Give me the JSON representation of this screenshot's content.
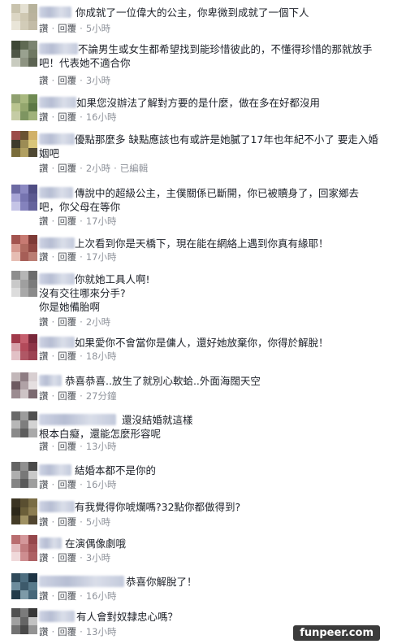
{
  "actions": {
    "like": "讚",
    "reply": "回覆",
    "edited": "已編輯"
  },
  "comments": [
    {
      "text": "你成就了一位偉大的公主，你卑微到成就了一個下人",
      "time": "5小時"
    },
    {
      "text": "不論男生或女生都希望找到能珍惜彼此的，不懂得珍惜的那就放手吧！代表她不適合你",
      "time": "3小時"
    },
    {
      "text": "如果您沒辦法了解對方要的是什麼，做在多在好都沒用",
      "time": "16小時"
    },
    {
      "text": "優點那麼多 缺點應該也有或許是她膩了17年也年紀不小了 要走入婚姻吧",
      "time": "2小時"
    },
    {
      "text": "傳說中的超級公主，主僕關係已斷開，你已被贖身了，回家鄉去吧，你父母在等你",
      "time": "17小時"
    },
    {
      "text": "上次看到你是天橋下，現在能在網絡上遇到你真有緣耶！",
      "time": "17小時"
    },
    {
      "text": "你就她工具人啊!\n沒有交往哪來分手?\n你是她備胎啊",
      "time": "2小時"
    },
    {
      "text": "如果愛你不會當你是傭人，還好她放棄你，你得於解脫！",
      "time": "18小時"
    },
    {
      "text": "恭喜恭喜..放生了就別心軟蛤..外面海闊天空",
      "time": "27分鐘"
    },
    {
      "text": "還沒結婚就這樣\n根本白癡，還能怎麼形容呢",
      "time": "13小時"
    },
    {
      "text": "結婚本都不是你的",
      "time": "16小時"
    },
    {
      "text": "有我覺得你唬爛嗎?32點你都做得到?",
      "time": "5小時"
    },
    {
      "text": "在演偶像劇哦",
      "time": "3小時"
    },
    {
      "text": "恭喜你解脫了！",
      "time": "16小時"
    },
    {
      "text": "有人會對奴隸忠心嗎？",
      "time": "13小時"
    }
  ],
  "watermark": "funpeer.com"
}
